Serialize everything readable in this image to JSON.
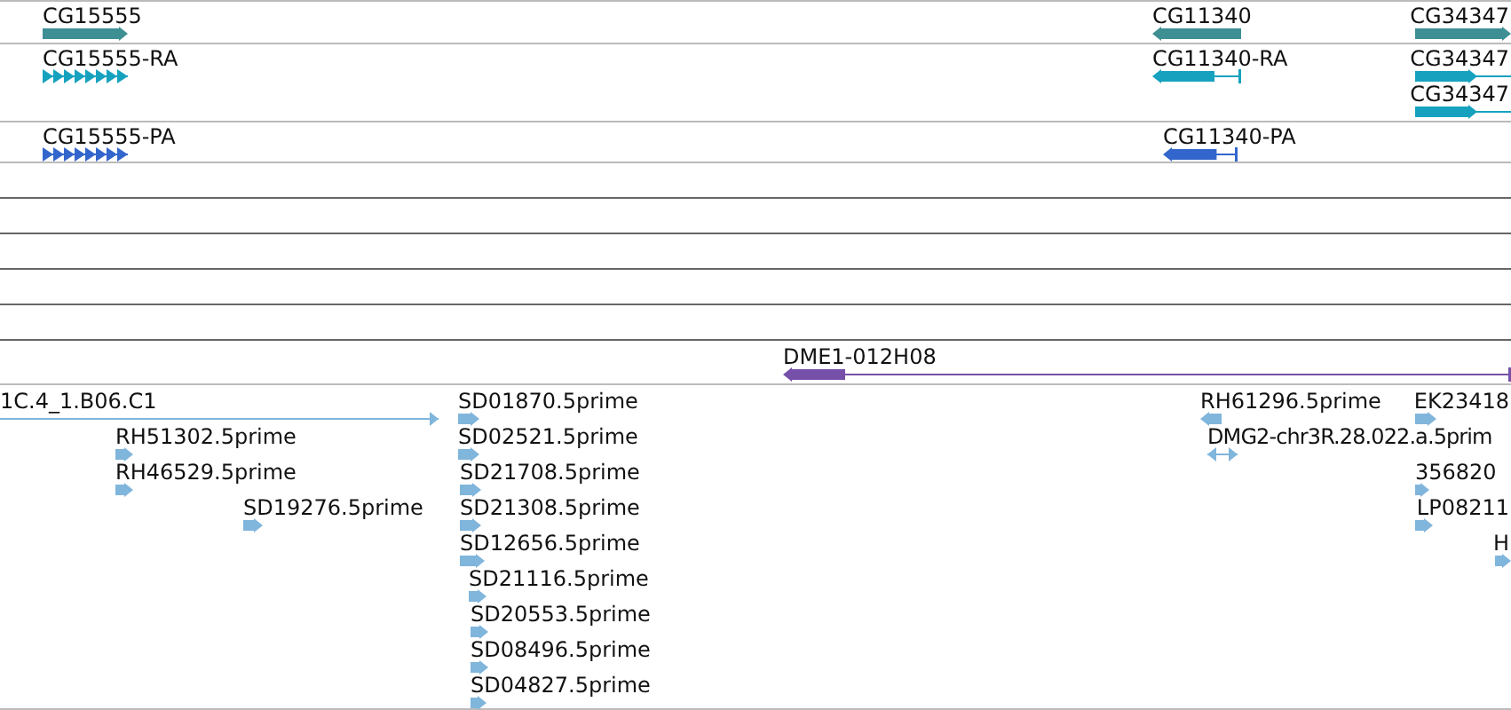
{
  "tracks": [
    {
      "kind": "features",
      "color": "#3d8f94",
      "features": [
        {
          "label": "CG15555",
          "kind": "block",
          "reverse": false
        },
        {
          "label": "CG11340",
          "kind": "block",
          "reverse": true
        },
        {
          "label": "CG34347",
          "kind": "block",
          "reverse": false
        }
      ]
    },
    {
      "kind": "features",
      "color": "#16a2bf",
      "features": [
        {
          "label": "CG15555-RA",
          "kind": "chain",
          "reverse": false
        },
        {
          "label": "CG11340-RA",
          "kind": "spliced",
          "reverse": true
        },
        {
          "label": "CG34347",
          "kind": "spliced",
          "reverse": false
        },
        {
          "label": "CG34347",
          "kind": "spliced",
          "reverse": false
        }
      ]
    },
    {
      "kind": "features",
      "color": "#3366cc",
      "features": [
        {
          "label": "CG15555-PA",
          "kind": "chain",
          "reverse": false
        },
        {
          "label": "CG11340-PA",
          "kind": "spliced",
          "reverse": true
        }
      ]
    },
    {
      "kind": "empty"
    },
    {
      "kind": "empty"
    },
    {
      "kind": "empty"
    },
    {
      "kind": "empty"
    },
    {
      "kind": "empty"
    },
    {
      "kind": "features",
      "color": "#7650a8",
      "features": [
        {
          "label": "DME1-012H08",
          "kind": "spliced",
          "reverse": true
        }
      ]
    },
    {
      "kind": "features",
      "color": "#80b5dc",
      "features": [
        {
          "label": "1C.4_1.B06.C1",
          "kind": "line",
          "reverse": false
        },
        {
          "label": "SD01870.5prime",
          "kind": "block",
          "reverse": false
        },
        {
          "label": "RH61296.5prime",
          "kind": "block",
          "reverse": true
        },
        {
          "label": "EK23418",
          "kind": "block",
          "reverse": false
        },
        {
          "label": "RH51302.5prime",
          "kind": "block",
          "reverse": false
        },
        {
          "label": "SD02521.5prime",
          "kind": "block",
          "reverse": false
        },
        {
          "label": "DMG2-chr3R.28.022.a.5prim",
          "kind": "twoway"
        },
        {
          "label": "RH46529.5prime",
          "kind": "block",
          "reverse": false
        },
        {
          "label": "SD21708.5prime",
          "kind": "block",
          "reverse": false
        },
        {
          "label": "356820",
          "kind": "block",
          "reverse": false
        },
        {
          "label": "SD19276.5prime",
          "kind": "block",
          "reverse": false
        },
        {
          "label": "SD21308.5prime",
          "kind": "block",
          "reverse": false
        },
        {
          "label": "LP08211",
          "kind": "block",
          "reverse": false
        },
        {
          "label": "SD12656.5prime",
          "kind": "block",
          "reverse": false
        },
        {
          "label": "H",
          "kind": "block",
          "reverse": false
        },
        {
          "label": "SD21116.5prime",
          "kind": "block",
          "reverse": false
        },
        {
          "label": "SD20553.5prime",
          "kind": "block",
          "reverse": false
        },
        {
          "label": "SD08496.5prime",
          "kind": "block",
          "reverse": false
        },
        {
          "label": "SD04827.5prime",
          "kind": "block",
          "reverse": false
        }
      ]
    }
  ]
}
